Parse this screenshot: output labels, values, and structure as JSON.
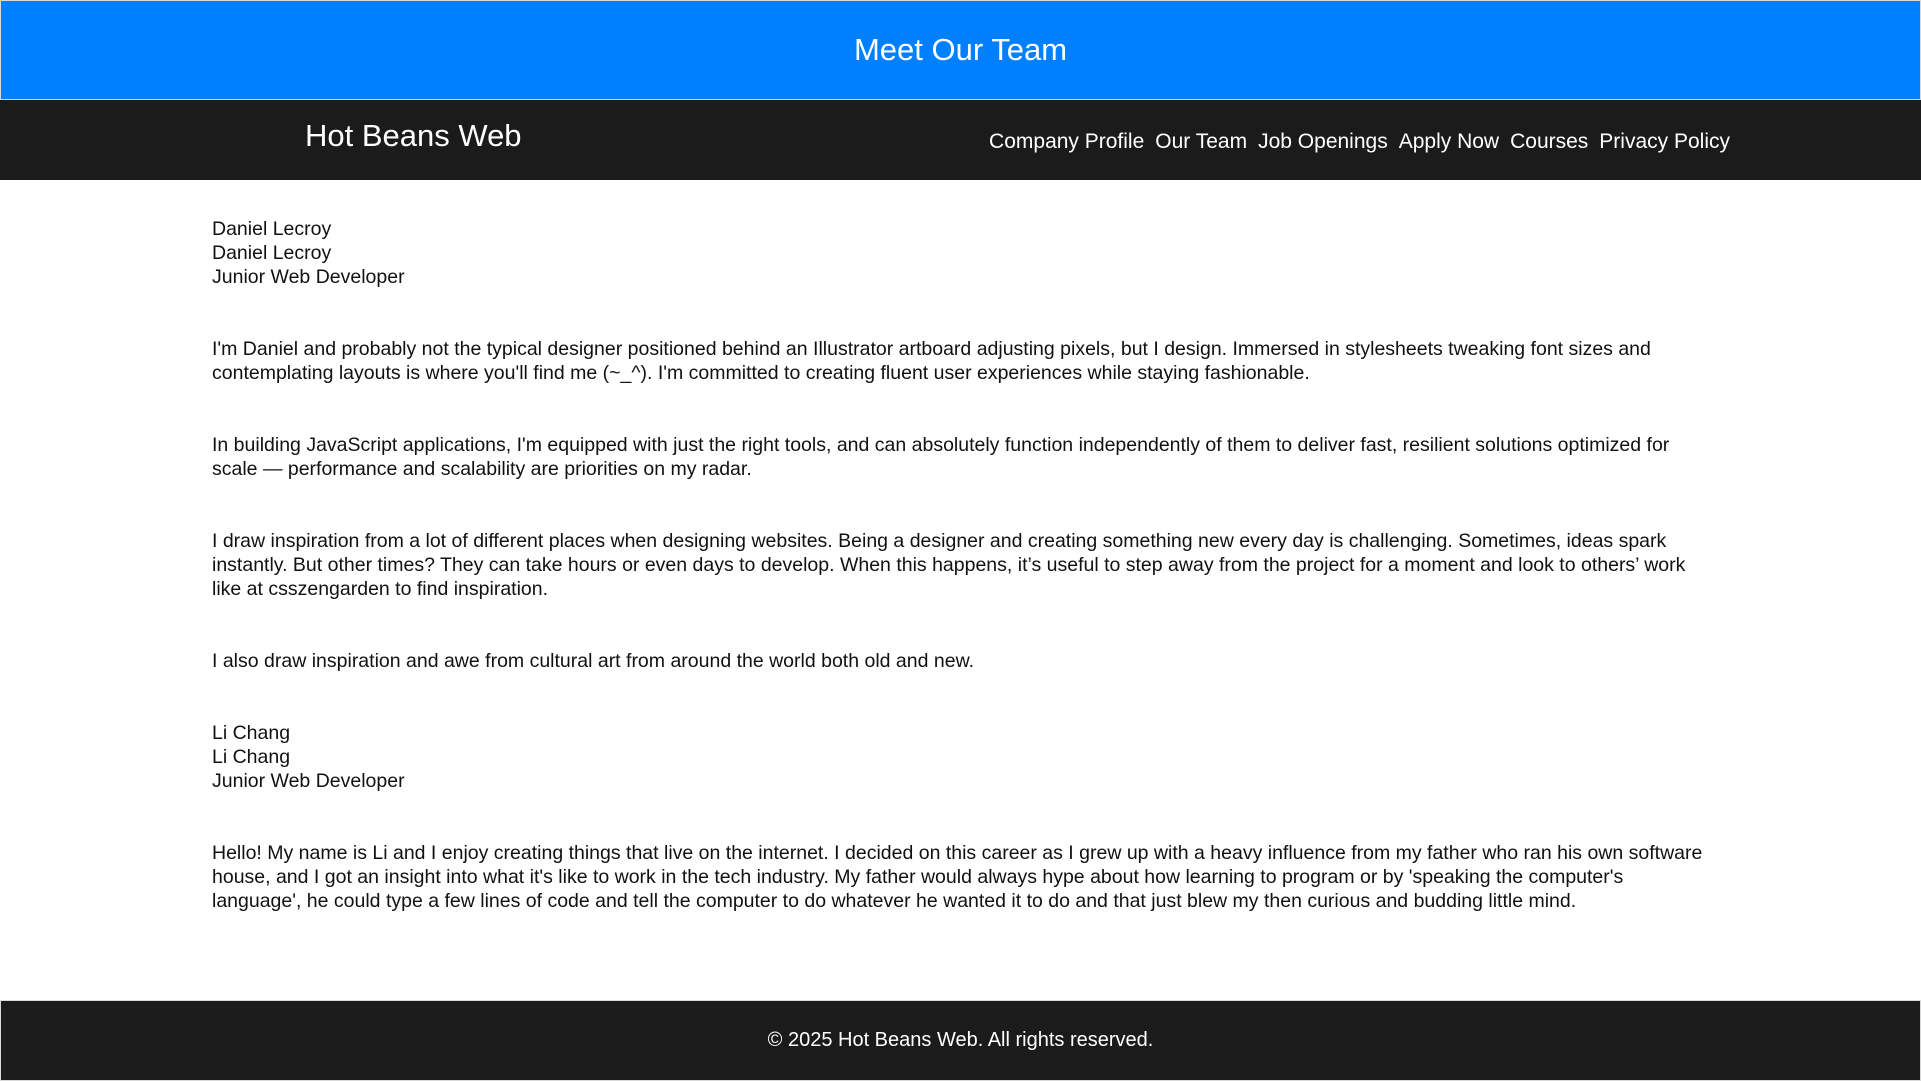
{
  "banner": {
    "title": "Meet Our Team"
  },
  "nav": {
    "brand": "Hot Beans Web",
    "links": [
      "Company Profile",
      "Our Team",
      "Job Openings",
      "Apply Now",
      "Courses",
      "Privacy Policy"
    ]
  },
  "team": [
    {
      "name": "Daniel Lecroy",
      "name_repeat": "Daniel Lecroy",
      "title": "Junior Web Developer",
      "bio": [
        "I'm Daniel and probably not the typical designer positioned behind an Illustrator artboard adjusting pixels, but I design. Immersed in stylesheets tweaking font sizes and contemplating layouts is where you'll find me (~_^). I'm committed to creating fluent user experiences while staying fashionable.",
        "In building JavaScript applications, I'm equipped with just the right tools, and can absolutely function independently of them to deliver fast, resilient solutions optimized for scale — performance and scalability are priorities on my radar.",
        "I draw inspiration from a lot of different places when designing websites. Being a designer and creating something new every day is challenging. Sometimes, ideas spark instantly. But other times? They can take hours or even days to develop. When this happens, it’s useful to step away from the project for a moment and look to others’ work like at csszengarden to find inspiration.",
        "I also draw inspiration and awe from cultural art from around the world both old and new."
      ]
    },
    {
      "name": "Li Chang",
      "name_repeat": "Li Chang",
      "title": "Junior Web Developer",
      "bio": [
        "Hello! My name is Li and I enjoy creating things that live on the internet. I decided on this career as I grew up with a heavy influence from my father who ran his own software house, and I got an insight into what it's like to work in the tech industry. My father would always hype about how learning to program or by 'speaking the computer's language', he could type a few lines of code and tell the computer to do whatever he wanted it to do and that just blew my then curious and budding little mind."
      ]
    }
  ],
  "footer": {
    "text": "© 2025 Hot Beans Web. All rights reserved."
  },
  "colors": {
    "banner": "#0080ff",
    "nav": "#1b1b1b",
    "footer": "#1b1b1b"
  }
}
